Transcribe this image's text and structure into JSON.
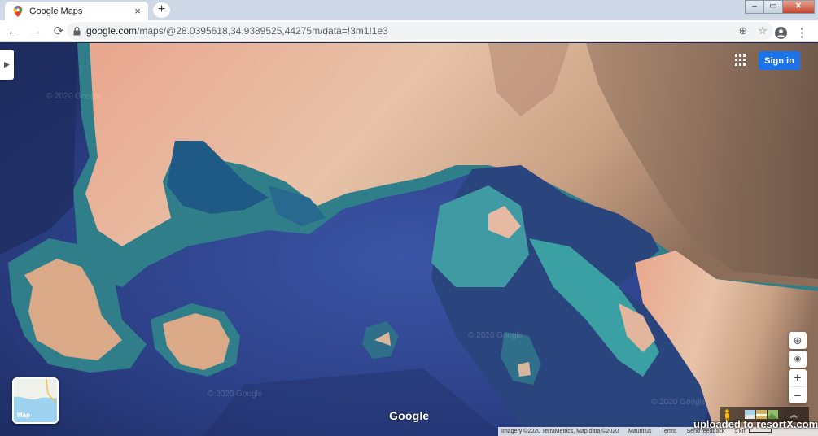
{
  "browser": {
    "tab_title": "Google Maps",
    "tab_close": "×",
    "new_tab": "+",
    "url_host": "google.com",
    "url_path": "/maps/@28.0395618,34.9389525,44275m/data=!3m1!1e3",
    "window_controls": {
      "minimize": "–",
      "maximize": "▭",
      "close": "✕"
    }
  },
  "icons": {
    "back": "back-icon",
    "forward": "forward-icon",
    "reload": "reload-icon",
    "lock": "lock-icon",
    "install": "plus-circle-icon",
    "bookmark": "star-icon",
    "profile": "account-icon",
    "menu": "kebab-menu-icon"
  },
  "glyphs": {
    "back": "←",
    "forward": "→",
    "reload": "⟳",
    "install": "⊕",
    "bookmark": "☆",
    "profile": "●",
    "menu": "⋮",
    "side_toggle": "▶",
    "globe": "⊕",
    "locate": "◉",
    "zoom_in": "+",
    "zoom_out": "−",
    "expand": "︽"
  },
  "maps": {
    "sign_in": "Sign in",
    "logo": "Google",
    "minimap_label": "Map",
    "watermark": "© 2020 Google",
    "attribution": {
      "imagery": "Imagery ©2020 TerraMetrics, Map data ©2020",
      "region": "Mauritius",
      "terms": "Terms",
      "feedback": "Send feedback",
      "scale": "5 km"
    }
  },
  "overlay": {
    "uploaded": "uploaded to resortX.com"
  },
  "colors": {
    "sign_in": "#1a73e8",
    "sea_deep": "#233470",
    "desert": "#e2b79a",
    "reef": "#4fa8a6"
  }
}
